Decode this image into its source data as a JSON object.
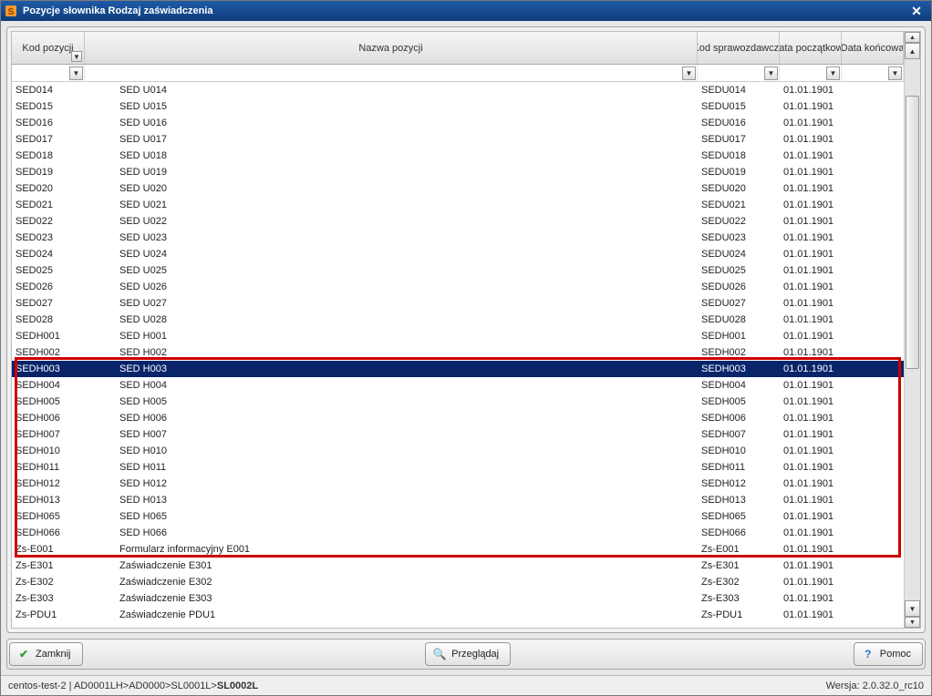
{
  "title": "Pozycje słownika Rodzaj zaświadczenia",
  "columns": {
    "kod_pozycji": "Kod pozycji",
    "nazwa_pozycji": "Nazwa pozycji",
    "kod_sprawozdawczy": "Kod sprawozdawczy",
    "data_poczatkowa": "Data początkowa",
    "data_koncowa": "Data końcowa"
  },
  "selected_index": 17,
  "highlight": {
    "start": 17,
    "end": 28
  },
  "rows": [
    {
      "kod": "SED014",
      "nazwa": "SED U014",
      "spraw": "SEDU014",
      "dp": "01.01.1901",
      "dk": ""
    },
    {
      "kod": "SED015",
      "nazwa": "SED U015",
      "spraw": "SEDU015",
      "dp": "01.01.1901",
      "dk": ""
    },
    {
      "kod": "SED016",
      "nazwa": "SED U016",
      "spraw": "SEDU016",
      "dp": "01.01.1901",
      "dk": ""
    },
    {
      "kod": "SED017",
      "nazwa": "SED U017",
      "spraw": "SEDU017",
      "dp": "01.01.1901",
      "dk": ""
    },
    {
      "kod": "SED018",
      "nazwa": "SED U018",
      "spraw": "SEDU018",
      "dp": "01.01.1901",
      "dk": ""
    },
    {
      "kod": "SED019",
      "nazwa": "SED U019",
      "spraw": "SEDU019",
      "dp": "01.01.1901",
      "dk": ""
    },
    {
      "kod": "SED020",
      "nazwa": "SED U020",
      "spraw": "SEDU020",
      "dp": "01.01.1901",
      "dk": ""
    },
    {
      "kod": "SED021",
      "nazwa": "SED U021",
      "spraw": "SEDU021",
      "dp": "01.01.1901",
      "dk": ""
    },
    {
      "kod": "SED022",
      "nazwa": "SED U022",
      "spraw": "SEDU022",
      "dp": "01.01.1901",
      "dk": ""
    },
    {
      "kod": "SED023",
      "nazwa": "SED U023",
      "spraw": "SEDU023",
      "dp": "01.01.1901",
      "dk": ""
    },
    {
      "kod": "SED024",
      "nazwa": "SED U024",
      "spraw": "SEDU024",
      "dp": "01.01.1901",
      "dk": ""
    },
    {
      "kod": "SED025",
      "nazwa": "SED U025",
      "spraw": "SEDU025",
      "dp": "01.01.1901",
      "dk": ""
    },
    {
      "kod": "SED026",
      "nazwa": "SED U026",
      "spraw": "SEDU026",
      "dp": "01.01.1901",
      "dk": ""
    },
    {
      "kod": "SED027",
      "nazwa": "SED U027",
      "spraw": "SEDU027",
      "dp": "01.01.1901",
      "dk": ""
    },
    {
      "kod": "SED028",
      "nazwa": "SED U028",
      "spraw": "SEDU028",
      "dp": "01.01.1901",
      "dk": ""
    },
    {
      "kod": "SEDH001",
      "nazwa": "SED H001",
      "spraw": "SEDH001",
      "dp": "01.01.1901",
      "dk": ""
    },
    {
      "kod": "SEDH002",
      "nazwa": "SED H002",
      "spraw": "SEDH002",
      "dp": "01.01.1901",
      "dk": ""
    },
    {
      "kod": "SEDH003",
      "nazwa": "SED H003",
      "spraw": "SEDH003",
      "dp": "01.01.1901",
      "dk": ""
    },
    {
      "kod": "SEDH004",
      "nazwa": "SED H004",
      "spraw": "SEDH004",
      "dp": "01.01.1901",
      "dk": ""
    },
    {
      "kod": "SEDH005",
      "nazwa": "SED H005",
      "spraw": "SEDH005",
      "dp": "01.01.1901",
      "dk": ""
    },
    {
      "kod": "SEDH006",
      "nazwa": "SED H006",
      "spraw": "SEDH006",
      "dp": "01.01.1901",
      "dk": ""
    },
    {
      "kod": "SEDH007",
      "nazwa": "SED H007",
      "spraw": "SEDH007",
      "dp": "01.01.1901",
      "dk": ""
    },
    {
      "kod": "SEDH010",
      "nazwa": "SED H010",
      "spraw": "SEDH010",
      "dp": "01.01.1901",
      "dk": ""
    },
    {
      "kod": "SEDH011",
      "nazwa": "SED H011",
      "spraw": "SEDH011",
      "dp": "01.01.1901",
      "dk": ""
    },
    {
      "kod": "SEDH012",
      "nazwa": "SED H012",
      "spraw": "SEDH012",
      "dp": "01.01.1901",
      "dk": ""
    },
    {
      "kod": "SEDH013",
      "nazwa": "SED H013",
      "spraw": "SEDH013",
      "dp": "01.01.1901",
      "dk": ""
    },
    {
      "kod": "SEDH065",
      "nazwa": "SED H065",
      "spraw": "SEDH065",
      "dp": "01.01.1901",
      "dk": ""
    },
    {
      "kod": "SEDH066",
      "nazwa": "SED H066",
      "spraw": "SEDH066",
      "dp": "01.01.1901",
      "dk": ""
    },
    {
      "kod": "Zs-E001",
      "nazwa": "Formularz informacyjny E001",
      "spraw": "Zs-E001",
      "dp": "01.01.1901",
      "dk": ""
    },
    {
      "kod": "Zs-E301",
      "nazwa": "Zaświadczenie E301",
      "spraw": "Zs-E301",
      "dp": "01.01.1901",
      "dk": ""
    },
    {
      "kod": "Zs-E302",
      "nazwa": "Zaświadczenie E302",
      "spraw": "Zs-E302",
      "dp": "01.01.1901",
      "dk": ""
    },
    {
      "kod": "Zs-E303",
      "nazwa": "Zaświadczenie E303",
      "spraw": "Zs-E303",
      "dp": "01.01.1901",
      "dk": ""
    },
    {
      "kod": "Zs-PDU1",
      "nazwa": "Zaświadczenie PDU1",
      "spraw": "Zs-PDU1",
      "dp": "01.01.1901",
      "dk": ""
    }
  ],
  "buttons": {
    "close": "Zamknij",
    "browse": "Przeglądaj",
    "help": "Pomoc"
  },
  "statusbar": {
    "host": "centos-test-2",
    "breadcrumb_pre": "AD0001LH>AD0000>SL0001L>",
    "breadcrumb_last": "SL0002L",
    "version_label": "Wersja:",
    "version_value": "2.0.32.0_rc10"
  }
}
